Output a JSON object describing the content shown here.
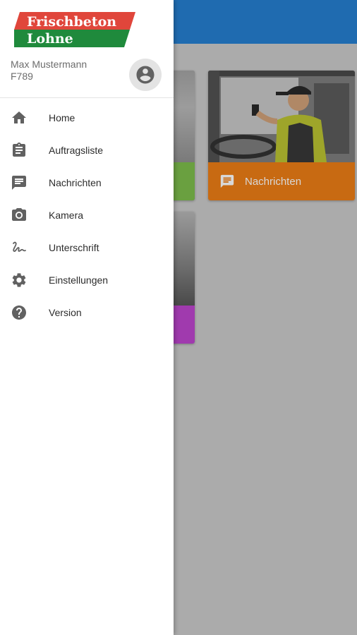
{
  "app": {
    "logo_line1": "Frischbeton",
    "logo_line2": "Lohne",
    "colors": {
      "appbar": "#1f6bb0",
      "logo_red": "#e0463b",
      "logo_green": "#1f8a3c",
      "card_green": "#6aa040",
      "card_orange": "#c86a12",
      "card_purple": "#a03aae"
    }
  },
  "user": {
    "name": "Max Mustermann",
    "id": "F789",
    "avatar_icon": "account-circle-icon"
  },
  "menu": [
    {
      "label": "Home",
      "icon": "home-icon"
    },
    {
      "label": "Auftragsliste",
      "icon": "clipboard-icon"
    },
    {
      "label": "Nachrichten",
      "icon": "message-icon"
    },
    {
      "label": "Kamera",
      "icon": "camera-icon"
    },
    {
      "label": "Unterschrift",
      "icon": "signature-icon"
    },
    {
      "label": "Einstellungen",
      "icon": "gear-icon"
    },
    {
      "label": "Version",
      "icon": "help-icon"
    }
  ],
  "cards": {
    "nachrichten_label": "Nachrichten"
  }
}
